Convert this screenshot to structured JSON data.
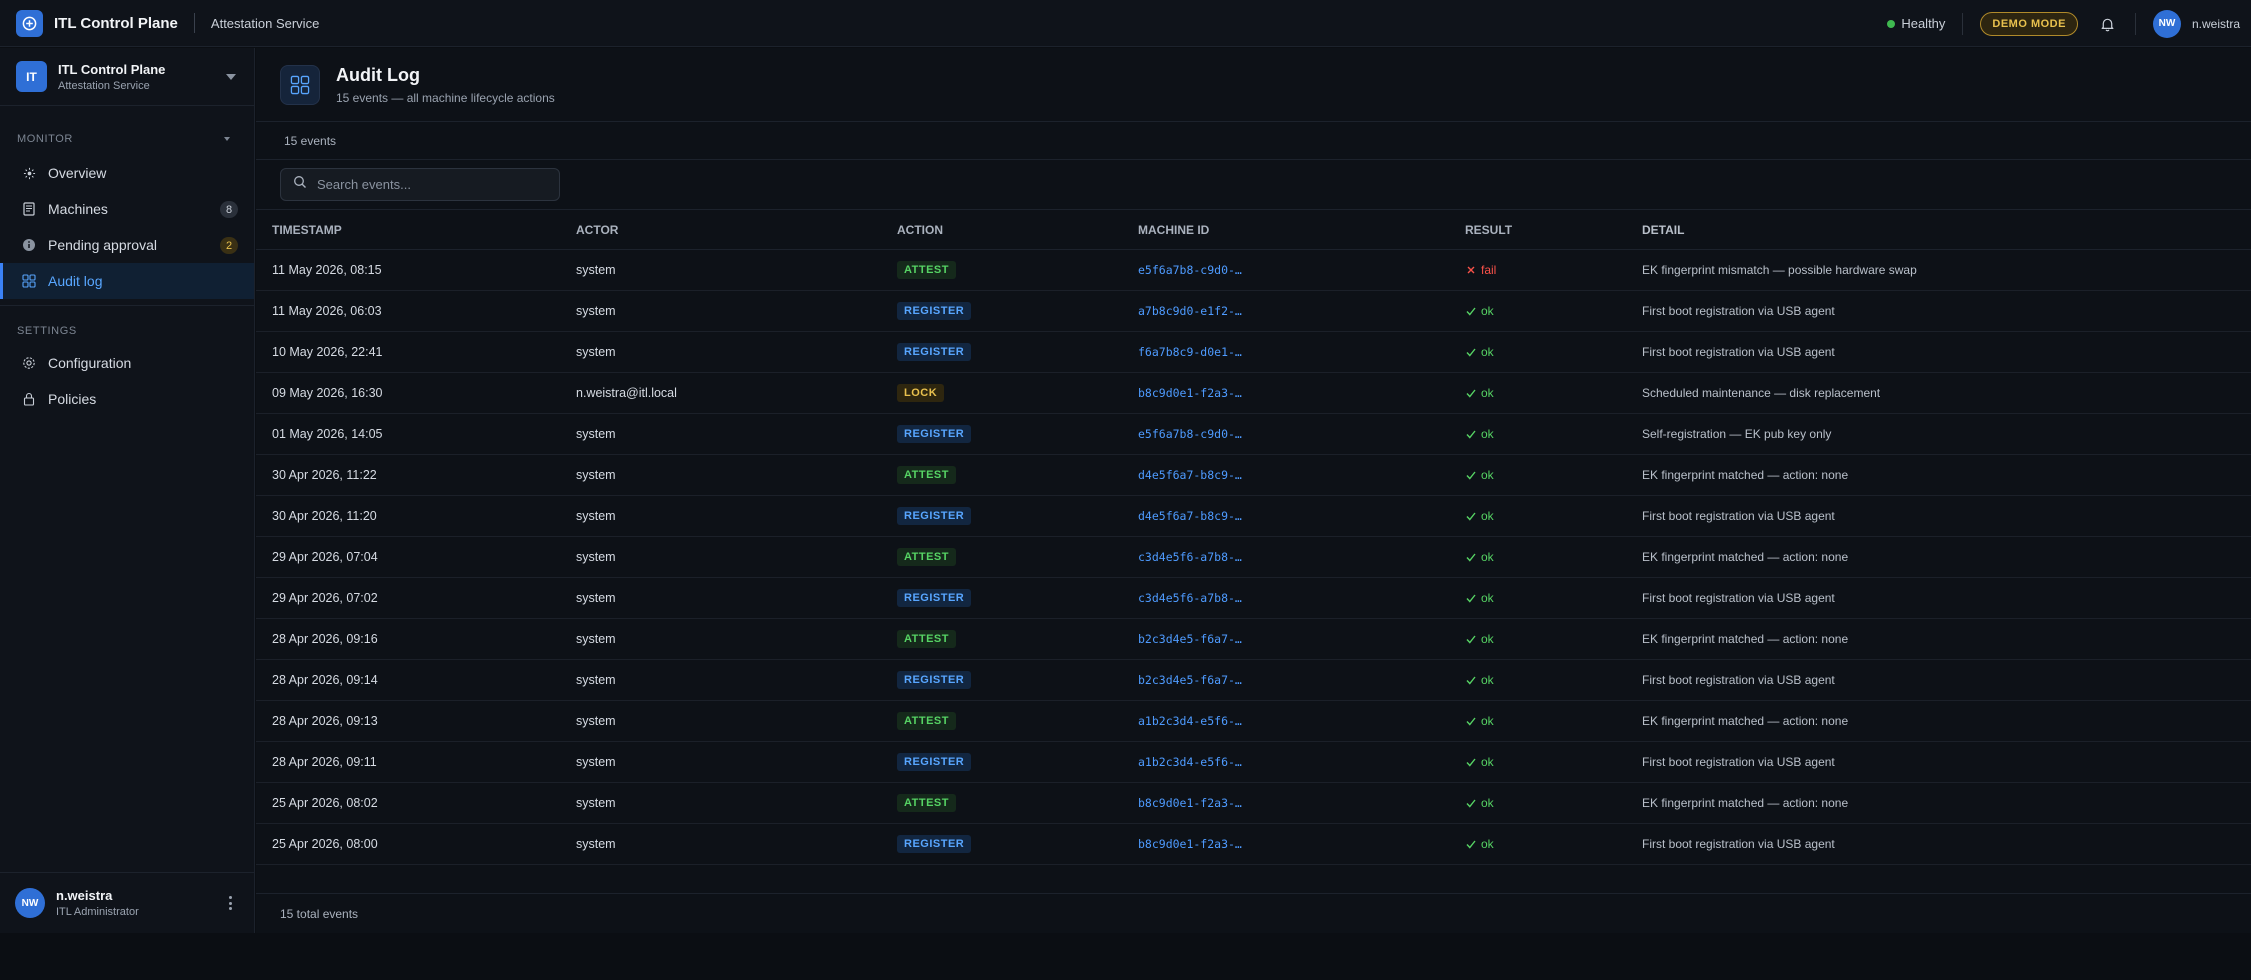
{
  "topbar": {
    "app_title": "ITL Control Plane",
    "service": "Attestation Service",
    "health": "Healthy",
    "demo_badge": "DEMO MODE",
    "user_initials": "NW",
    "username": "n.weistra"
  },
  "sidebar": {
    "workspace": {
      "initials": "IT",
      "name": "ITL Control Plane",
      "sub": "Attestation Service"
    },
    "sections": [
      {
        "title": "MONITOR"
      },
      {
        "title": "SETTINGS"
      }
    ],
    "items": [
      {
        "label": "Overview",
        "icon": "overview-icon"
      },
      {
        "label": "Machines",
        "icon": "machines-icon",
        "badge": "8"
      },
      {
        "label": "Pending approval",
        "icon": "info-icon",
        "badge": "2"
      },
      {
        "label": "Audit log",
        "icon": "grid-icon",
        "active": true
      },
      {
        "label": "Configuration",
        "icon": "gear-icon"
      },
      {
        "label": "Policies",
        "icon": "lock-icon"
      }
    ],
    "user": {
      "initials": "NW",
      "name": "n.weistra",
      "role": "ITL Administrator"
    }
  },
  "page": {
    "title": "Audit Log",
    "subtitle": "15 events — all machine lifecycle actions",
    "count": "15 events",
    "search_placeholder": "Search events...",
    "footer": "15 total events"
  },
  "table": {
    "columns": [
      "TIMESTAMP",
      "ACTOR",
      "ACTION",
      "MACHINE ID",
      "RESULT",
      "DETAIL"
    ],
    "rows": [
      {
        "ts": "11 May 2026, 08:15",
        "actor": "system",
        "action": "ATTEST",
        "mid": "e5f6a7b8-c9d0-…",
        "result": "fail",
        "detail": "EK fingerprint mismatch — possible hardware swap"
      },
      {
        "ts": "11 May 2026, 06:03",
        "actor": "system",
        "action": "REGISTER",
        "mid": "a7b8c9d0-e1f2-…",
        "result": "ok",
        "detail": "First boot registration via USB agent"
      },
      {
        "ts": "10 May 2026, 22:41",
        "actor": "system",
        "action": "REGISTER",
        "mid": "f6a7b8c9-d0e1-…",
        "result": "ok",
        "detail": "First boot registration via USB agent"
      },
      {
        "ts": "09 May 2026, 16:30",
        "actor": "n.weistra@itl.local",
        "action": "LOCK",
        "mid": "b8c9d0e1-f2a3-…",
        "result": "ok",
        "detail": "Scheduled maintenance — disk replacement"
      },
      {
        "ts": "01 May 2026, 14:05",
        "actor": "system",
        "action": "REGISTER",
        "mid": "e5f6a7b8-c9d0-…",
        "result": "ok",
        "detail": "Self-registration — EK pub key only"
      },
      {
        "ts": "30 Apr 2026, 11:22",
        "actor": "system",
        "action": "ATTEST",
        "mid": "d4e5f6a7-b8c9-…",
        "result": "ok",
        "detail": "EK fingerprint matched — action: none"
      },
      {
        "ts": "30 Apr 2026, 11:20",
        "actor": "system",
        "action": "REGISTER",
        "mid": "d4e5f6a7-b8c9-…",
        "result": "ok",
        "detail": "First boot registration via USB agent"
      },
      {
        "ts": "29 Apr 2026, 07:04",
        "actor": "system",
        "action": "ATTEST",
        "mid": "c3d4e5f6-a7b8-…",
        "result": "ok",
        "detail": "EK fingerprint matched — action: none"
      },
      {
        "ts": "29 Apr 2026, 07:02",
        "actor": "system",
        "action": "REGISTER",
        "mid": "c3d4e5f6-a7b8-…",
        "result": "ok",
        "detail": "First boot registration via USB agent"
      },
      {
        "ts": "28 Apr 2026, 09:16",
        "actor": "system",
        "action": "ATTEST",
        "mid": "b2c3d4e5-f6a7-…",
        "result": "ok",
        "detail": "EK fingerprint matched — action: none"
      },
      {
        "ts": "28 Apr 2026, 09:14",
        "actor": "system",
        "action": "REGISTER",
        "mid": "b2c3d4e5-f6a7-…",
        "result": "ok",
        "detail": "First boot registration via USB agent"
      },
      {
        "ts": "28 Apr 2026, 09:13",
        "actor": "system",
        "action": "ATTEST",
        "mid": "a1b2c3d4-e5f6-…",
        "result": "ok",
        "detail": "EK fingerprint matched — action: none"
      },
      {
        "ts": "28 Apr 2026, 09:11",
        "actor": "system",
        "action": "REGISTER",
        "mid": "a1b2c3d4-e5f6-…",
        "result": "ok",
        "detail": "First boot registration via USB agent"
      },
      {
        "ts": "25 Apr 2026, 08:02",
        "actor": "system",
        "action": "ATTEST",
        "mid": "b8c9d0e1-f2a3-…",
        "result": "ok",
        "detail": "EK fingerprint matched — action: none"
      },
      {
        "ts": "25 Apr 2026, 08:00",
        "actor": "system",
        "action": "REGISTER",
        "mid": "b8c9d0e1-f2a3-…",
        "result": "ok",
        "detail": "First boot registration via USB agent"
      }
    ]
  },
  "colors": {
    "accent": "#2f6fd6",
    "ok": "#56d364",
    "fail": "#f85149",
    "warn": "#e9c14e"
  }
}
